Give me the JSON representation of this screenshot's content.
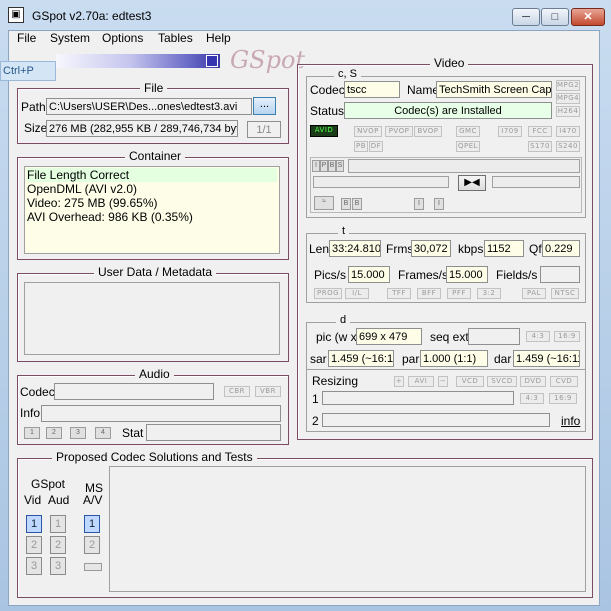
{
  "window": {
    "title": "GSpot v2.70a: edtest3",
    "icon": "film-frame-icon",
    "logo_text": "GSpot",
    "controls": {
      "minimize": "─",
      "maximize": "□",
      "close": "✕"
    }
  },
  "side_tip": "Ctrl+P",
  "menu": [
    "File",
    "System",
    "Options",
    "Tables",
    "Help"
  ],
  "file": {
    "group_title": "File",
    "path_label": "Path",
    "path_value": "C:\\Users\\USER\\Des...ones\\edtest3.avi",
    "browse_label": "...",
    "size_label": "Size",
    "size_value": "276 MB (282,955 KB / 289,746,734 bytes)",
    "page_counter": "1/1"
  },
  "container": {
    "group_title": "Container",
    "lines": [
      "File Length Correct",
      "OpenDML (AVI v2.0)",
      "Video: 275 MB (99.65%)",
      "AVI Overhead: 986 KB (0.35%)"
    ]
  },
  "userdata": {
    "group_title": "User Data / Metadata"
  },
  "audio": {
    "group_title": "Audio",
    "codec_label": "Codec",
    "cbr": "CBR",
    "vbr": "VBR",
    "info_label": "Info",
    "stream_buttons": [
      "1",
      "2",
      "3",
      "4"
    ],
    "stat_label": "Stat"
  },
  "proposed": {
    "group_title": "Proposed Codec Solutions and Tests",
    "gspot_label": "GSpot",
    "vid_label": "Vid",
    "aud_label": "Aud",
    "ms_label": "MS",
    "av_label": "A/V",
    "vid_buttons": [
      "1",
      "2",
      "3"
    ],
    "aud_buttons": [
      "1",
      "2",
      "3"
    ],
    "ms_buttons": [
      "1",
      "2"
    ]
  },
  "video": {
    "group_title": "Video",
    "codec_section": "c, S",
    "codec_label": "Codec",
    "codec_value": "tscc",
    "name_label": "Name",
    "name_value": "TechSmith Screen Capt",
    "status_label": "Status",
    "status_value": "Codec(s) are Installed",
    "mpg_flags": [
      "MPG2",
      "MPG4",
      "H264"
    ],
    "avid_flag": "AVID",
    "flags_row1": [
      "NVOP",
      "PVOP",
      "BVOP",
      "GMC",
      "I709",
      "FCC",
      "I470"
    ],
    "flags_row2": [
      "PB",
      "DF",
      "QPEL",
      "S170",
      "S240"
    ],
    "ipbs": [
      "I",
      "P",
      "B",
      "S"
    ],
    "frame_marks": [
      "B",
      "B",
      "I",
      "I"
    ],
    "time_section": "t",
    "len_label": "Len",
    "len_value": "33:24.810",
    "frms_label": "Frms",
    "frms_value": "30,072",
    "kbps_label": "kbps",
    "kbps_value": "1152",
    "qf_label": "Qf",
    "qf_value": "0.229",
    "pics_label": "Pics/s",
    "pics_value": "15.000",
    "frames_label": "Frames/s",
    "frames_value": "15.000",
    "fields_label": "Fields/s",
    "fields_value": "",
    "scan_flags": [
      "PROG",
      "I/L",
      "TFF",
      "BFF",
      "PFF",
      "3:2",
      "PAL",
      "NTSC"
    ],
    "dim_section": "d",
    "pic_label": "pic (w x",
    "pic_value": "699 x 479",
    "seqext_label": "seq ext",
    "aspect_flags": [
      "4:3",
      "16:9"
    ],
    "sar_label": "sar",
    "sar_value": "1.459 (~16:11)",
    "par_label": "par",
    "par_value": "1.000 (1:1)",
    "dar_label": "dar",
    "dar_value": "1.459 (~16:11)",
    "resizing_label": "Resizing",
    "resize_buttons": [
      "+",
      "AVI",
      "−",
      "VCD",
      "SVCD",
      "DVD",
      "CVD"
    ],
    "row1_label": "1",
    "row2_label": "2",
    "info_link": "info"
  }
}
